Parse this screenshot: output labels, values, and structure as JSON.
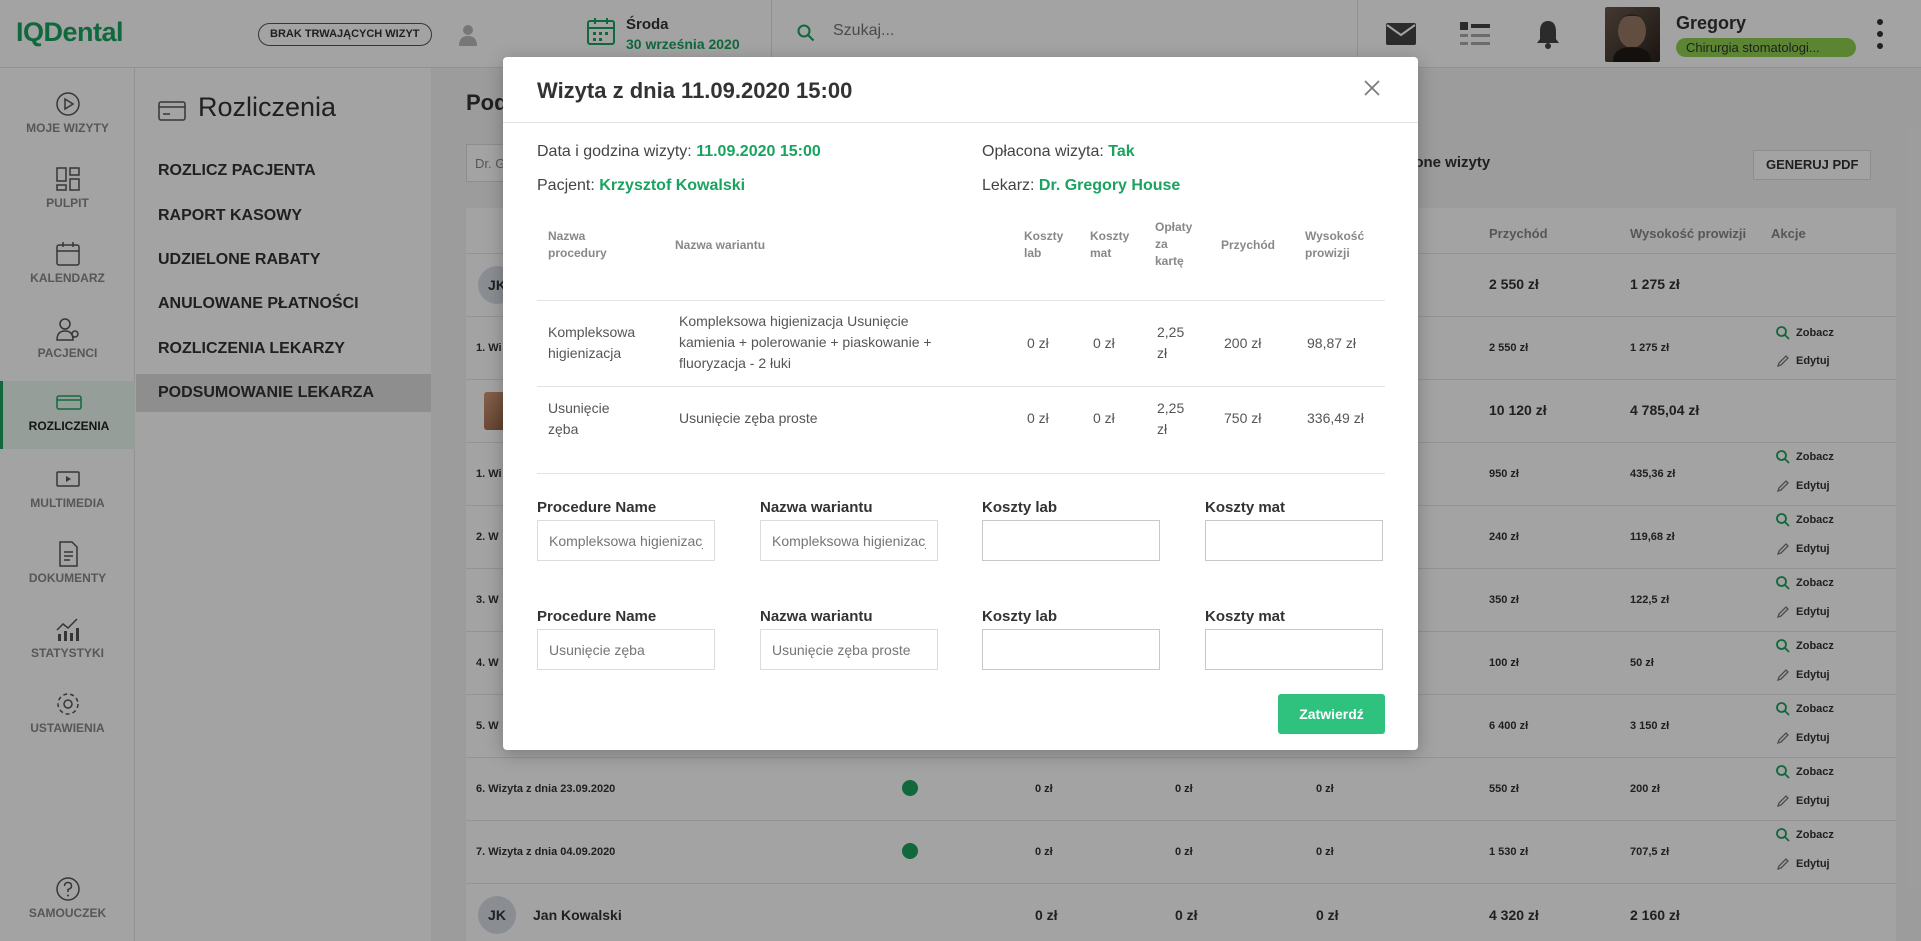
{
  "app": {
    "logo": "IQDental"
  },
  "topbar": {
    "visit_status": "BRAK TRWAJĄCYCH WIZYT",
    "date_day": "Środa",
    "date_full": "30 września 2020",
    "search_placeholder": "Szukaj...",
    "user_name": "Gregory",
    "user_role": "Chirurgia stomatologi..."
  },
  "leftnav": {
    "items": [
      {
        "label": "MOJE WIZYTY",
        "icon": "play-circle-icon"
      },
      {
        "label": "PULPIT",
        "icon": "dashboard-icon"
      },
      {
        "label": "KALENDARZ",
        "icon": "calendar-icon"
      },
      {
        "label": "PACJENCI",
        "icon": "patients-icon"
      },
      {
        "label": "ROZLICZENIA",
        "icon": "billing-card-icon",
        "active": true
      },
      {
        "label": "MULTIMEDIA",
        "icon": "multimedia-icon"
      },
      {
        "label": "DOKUMENTY",
        "icon": "document-icon"
      },
      {
        "label": "STATYSTYKI",
        "icon": "statistics-icon"
      },
      {
        "label": "USTAWIENIA",
        "icon": "settings-gear-icon"
      }
    ],
    "help": {
      "label": "SAMOUCZEK",
      "icon": "help-circle-icon"
    }
  },
  "subnav": {
    "title": "Rozliczenia",
    "items": [
      {
        "label": "ROZLICZ PACJENTA"
      },
      {
        "label": "RAPORT KASOWY"
      },
      {
        "label": "UDZIELONE RABATY"
      },
      {
        "label": "ANULOWANE PŁATNOŚCI"
      },
      {
        "label": "ROZLICZENIA LEKARZY"
      },
      {
        "label": "PODSUMOWANIE LEKARZA",
        "active": true
      }
    ]
  },
  "main": {
    "title": "Pod",
    "filter_value": "Dr. G",
    "paid_filter": "cone wizyty",
    "pdf_label": "GENERUJ PDF",
    "columns": {
      "income": "Przychód",
      "commission": "Wysokość prowizji",
      "actions": "Akcje"
    },
    "action_view": "Zobacz",
    "action_edit": "Edytuj",
    "rows": [
      {
        "kind": "patient",
        "avatar": "JK",
        "income": "2 550 zł",
        "commission": "1 275 zł"
      },
      {
        "kind": "visit",
        "prefix": "1. Wi",
        "income": "2 550 zł",
        "commission": "1 275 zł"
      },
      {
        "kind": "patient-photo",
        "income": "10 120 zł",
        "commission": "4 785,04 zł"
      },
      {
        "kind": "visit",
        "prefix": "1. Wi",
        "income": "950 zł",
        "commission": "435,36 zł"
      },
      {
        "kind": "visit",
        "prefix": "2. W",
        "income": "240 zł",
        "commission": "119,68 zł"
      },
      {
        "kind": "visit",
        "prefix": "3. W",
        "income": "350 zł",
        "commission": "122,5 zł"
      },
      {
        "kind": "visit",
        "prefix": "4. W",
        "income": "100 zł",
        "commission": "50 zł"
      },
      {
        "kind": "visit",
        "prefix": "5. W",
        "income": "6 400 zł",
        "commission": "3 150 zł"
      },
      {
        "kind": "visit-full",
        "name": "6. Wizyta z dnia 23.09.2020",
        "lab": "0 zł",
        "mat": "0 zł",
        "card": "0 zł",
        "income": "550 zł",
        "commission": "200 zł"
      },
      {
        "kind": "visit-full",
        "name": "7. Wizyta z dnia 04.09.2020",
        "lab": "0 zł",
        "mat": "0 zł",
        "card": "0 zł",
        "income": "1 530 zł",
        "commission": "707,5 zł"
      }
    ],
    "last_patient": {
      "avatar": "JK",
      "name": "Jan Kowalski",
      "lab": "0 zł",
      "mat": "0 zł",
      "card": "0 zł",
      "income": "4 320 zł",
      "commission": "2 160 zł"
    }
  },
  "modal": {
    "title": "Wizyta z dnia 11.09.2020 15:00",
    "date_label": "Data i godzina wizyty: ",
    "date_value": "11.09.2020 15:00",
    "paid_label": "Opłacona wizyta: ",
    "paid_value": "Tak",
    "patient_label": "Pacjent: ",
    "patient_value": "Krzysztof Kowalski",
    "doctor_label": "Lekarz: ",
    "doctor_value": "Dr. Gregory House",
    "table_headers": {
      "procedure": [
        "Nazwa",
        "procedury"
      ],
      "variant": "Nazwa wariantu",
      "lab": [
        "Koszty",
        "lab"
      ],
      "mat": [
        "Koszty",
        "mat"
      ],
      "card": [
        "Opłaty",
        "za",
        "kartę"
      ],
      "income": "Przychód",
      "commission": [
        "Wysokość",
        "prowizji"
      ]
    },
    "procedures": [
      {
        "procedure": [
          "Kompleksowa",
          "higienizacja"
        ],
        "variant": [
          "Kompleksowa higienizacja Usunięcie",
          "kamienia + polerowanie + piaskowanie +",
          "fluoryzacja - 2 łuki"
        ],
        "lab": "0 zł",
        "mat": "0 zł",
        "card": [
          "2,25",
          "zł"
        ],
        "income": "200 zł",
        "commission": "98,87 zł"
      },
      {
        "procedure": [
          "Usunięcie",
          "zęba"
        ],
        "variant": [
          "Usunięcie zęba proste"
        ],
        "lab": "0 zł",
        "mat": "0 zł",
        "card": [
          "2,25",
          "zł"
        ],
        "income": "750 zł",
        "commission": "336,49 zł"
      }
    ],
    "form_labels": {
      "procedure_name": "Procedure Name",
      "variant": "Nazwa wariantu",
      "lab": "Koszty lab",
      "mat": "Koszty mat"
    },
    "form_rows": [
      {
        "procedure_placeholder": "Kompleksowa higienizacja",
        "variant_placeholder": "Kompleksowa higienizacja"
      },
      {
        "procedure_placeholder": "Usunięcie zęba",
        "variant_placeholder": "Usunięcie zęba proste"
      }
    ],
    "confirm_label": "Zatwierdź"
  },
  "colors": {
    "brand": "#1aa35f",
    "accent_button": "#2ec27e",
    "role_badge": "#8fd14f"
  }
}
